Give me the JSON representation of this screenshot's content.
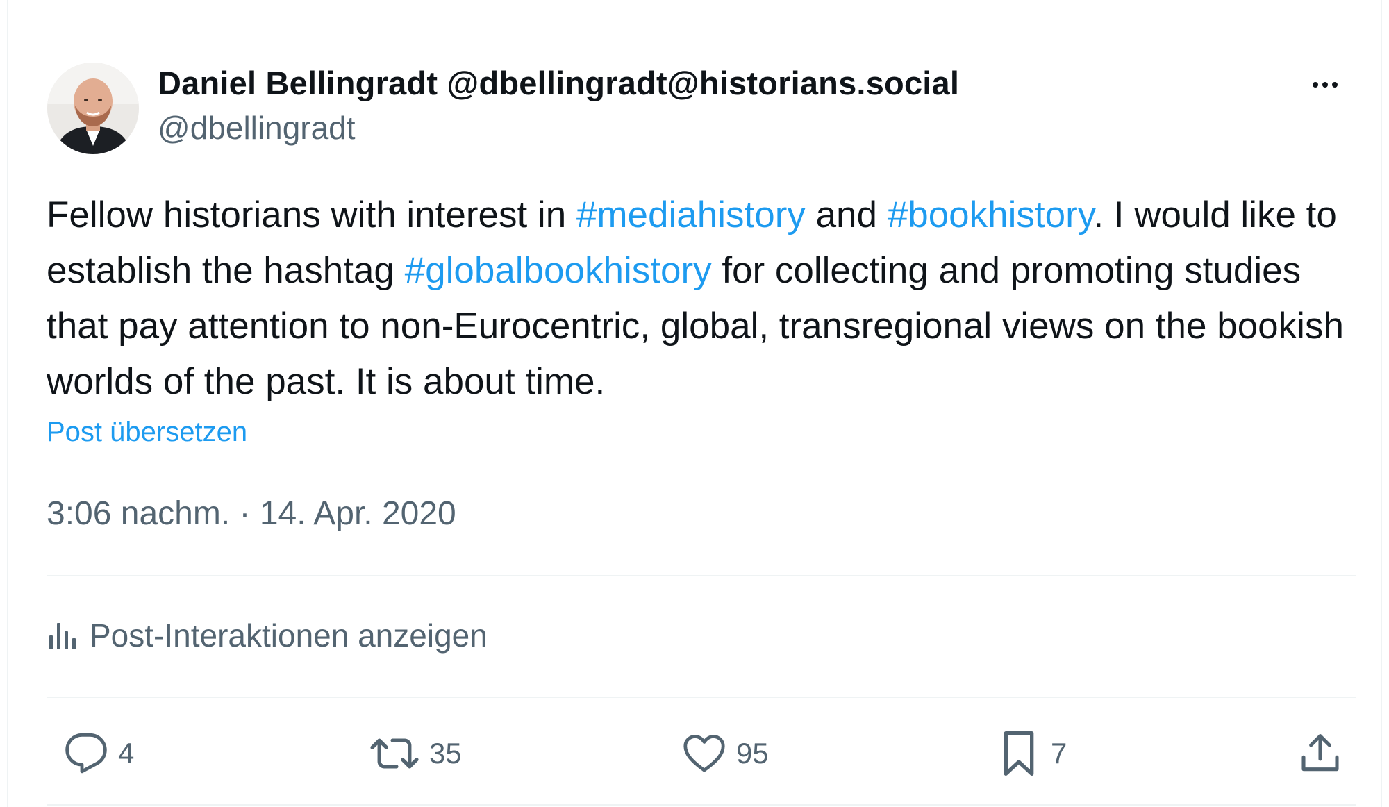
{
  "author": {
    "display_name": "Daniel Bellingradt @dbellingradt@historians.social",
    "handle": "@dbellingradt"
  },
  "post": {
    "text_1": "Fellow historians with interest in ",
    "hashtag_1": "#mediahistory",
    "text_2": " and ",
    "hashtag_2": "#bookhistory",
    "text_3": ". I would like to establish the hashtag ",
    "hashtag_3": "#globalbookhistory",
    "text_4": " for collecting and promoting studies that pay attention to non-Eurocentric, global, transregional views on the bookish worlds of the past. It is about time."
  },
  "translate_label": "Post übersetzen",
  "timestamp": "3:06 nachm. · 14. Apr. 2020",
  "analytics_label": "Post-Interaktionen anzeigen",
  "actions": {
    "replies": "4",
    "reposts": "35",
    "likes": "95",
    "bookmarks": "7"
  },
  "icons": {
    "more": "more-icon",
    "analytics": "analytics-icon",
    "reply": "reply-icon",
    "repost": "repost-icon",
    "like": "heart-icon",
    "bookmark": "bookmark-icon",
    "share": "share-icon"
  },
  "colors": {
    "link": "#1d9bf0",
    "secondary_text": "#536471",
    "primary_text": "#0f1419",
    "divider": "#eff3f4"
  }
}
